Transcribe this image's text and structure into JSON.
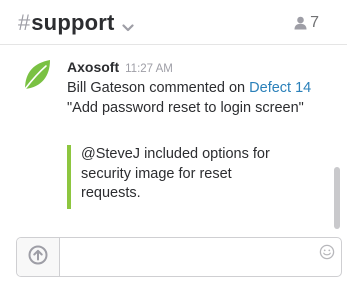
{
  "header": {
    "hash": "#",
    "channel_name": "support",
    "member_count": "7"
  },
  "message": {
    "sender": "Axosoft",
    "timestamp": "11:27 AM",
    "text_before_link": "Bill Gateson  commented on ",
    "link_text": "Defect 14",
    "text_after_link": " \"Add password reset to login screen\"",
    "quote": "@SteveJ included options for security image for reset requests.",
    "quote_color": "#8dc63f",
    "avatar_icon": "green-leaf-icon"
  },
  "composer": {
    "value": "",
    "placeholder": ""
  },
  "colors": {
    "link": "#2a80b9",
    "accent_green": "#7ac143"
  }
}
